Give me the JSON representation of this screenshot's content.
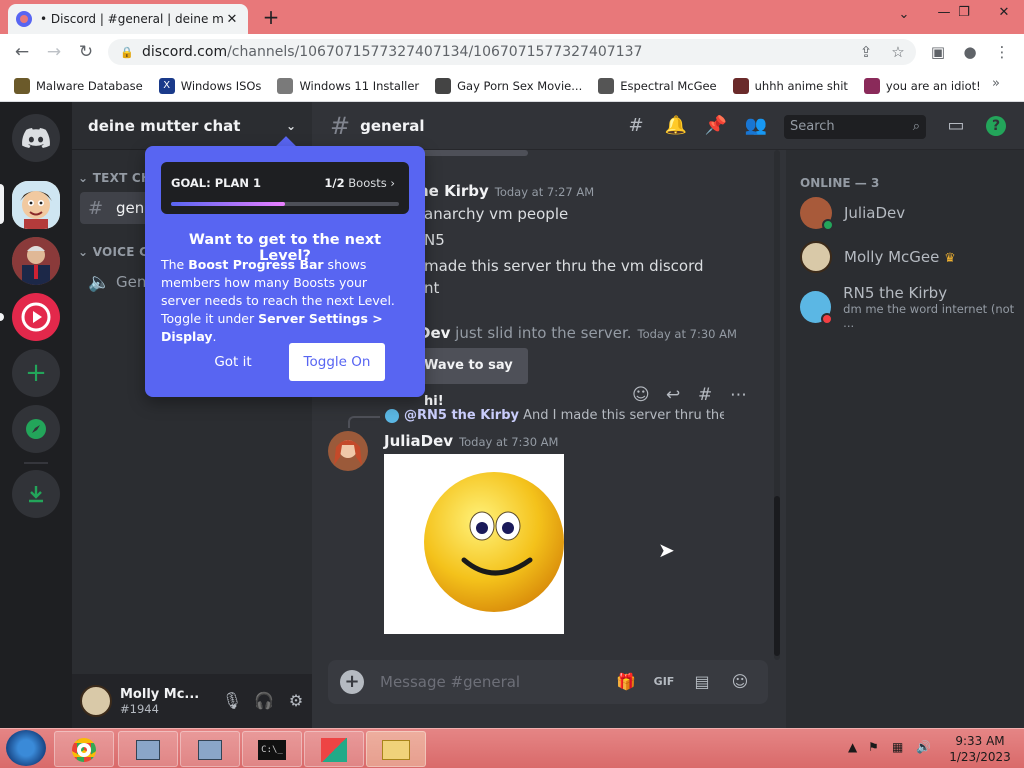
{
  "browser": {
    "tab_title": "• Discord | #general | deine mutter chat",
    "tab_close": "✕",
    "new_tab": "+",
    "url_host": "discord.com",
    "url_path": "/channels/1067071577327407134/1067071577327407137",
    "win_minimize": "⌄",
    "win_restore": "—",
    "win_max": "❐",
    "win_close": "✕"
  },
  "bookmarks": [
    {
      "label": "Malware Database",
      "icon": "person-icon",
      "color": "#6b5a2a"
    },
    {
      "label": "Windows ISOs",
      "icon": "x-icon",
      "color": "#1a3a8a"
    },
    {
      "label": "Windows 11 Installer",
      "icon": "globe-icon",
      "color": "#7a7a7a"
    },
    {
      "label": "Gay Porn Sex Movie...",
      "icon": "face-icon",
      "color": "#444444"
    },
    {
      "label": "Espectral McGee",
      "icon": "face-icon",
      "color": "#555555"
    },
    {
      "label": "uhhh anime shit",
      "icon": "anime-icon",
      "color": "#6a2a2a"
    },
    {
      "label": "you are an idiot!",
      "icon": "flag-icon",
      "color": "#8a2a5a"
    }
  ],
  "server": {
    "name": "deine mutter chat",
    "text_category": "TEXT CHA",
    "voice_category": "VOICE CHA",
    "text_channel": "gene",
    "voice_channel": "Gene"
  },
  "user": {
    "name": "Molly Mc...",
    "tag": "#1944"
  },
  "chat": {
    "channel": "general",
    "search_placeholder": "Search",
    "composer_placeholder": "Message #general"
  },
  "messages": {
    "author_partial": "he Kirby",
    "author_time": "Today at 7:27 AM",
    "line1": "anarchy vm people",
    "line2": "N5",
    "line3": "made this server thru the vm discord",
    "line4": "nt",
    "join_name": "Dev",
    "join_text": " just slid into the server.",
    "join_time": "Today at 7:30 AM",
    "wave_label": "Wave to say hi!",
    "reply_name": "@RN5 the Kirby",
    "reply_text": "And I made this server thru the vm d",
    "main_author": "JuliaDev",
    "main_time": "Today at 7:30 AM"
  },
  "members": {
    "header": "ONLINE — 3",
    "list": [
      {
        "name": "JuliaDev",
        "status": "",
        "dot": "#23a55a"
      },
      {
        "name": "Molly McGee",
        "status": "",
        "dot": ""
      },
      {
        "name": "RN5 the Kirby",
        "status": "dm me the word internet (not ...",
        "dot": "#f23f43"
      }
    ]
  },
  "popup": {
    "goal_label": "GOAL: PLAN 1",
    "goal_count": "1/2",
    "goal_unit": "Boosts",
    "progress": 0.5,
    "title": "Want to get to the next Level?",
    "body_1": "The ",
    "body_bold1": "Boost Progress Bar",
    "body_2": " shows members how many Boosts your server needs to reach the next Level. Toggle it under ",
    "body_bold2": "Server Settings > Display",
    "body_3": ".",
    "got_it": "Got it",
    "toggle_on": "Toggle On"
  },
  "taskbar": {
    "time": "9:33 AM",
    "date": "1/23/2023"
  },
  "colors": {
    "blurple": "#5865f2",
    "online": "#23a55a",
    "dnd": "#f23f43"
  }
}
